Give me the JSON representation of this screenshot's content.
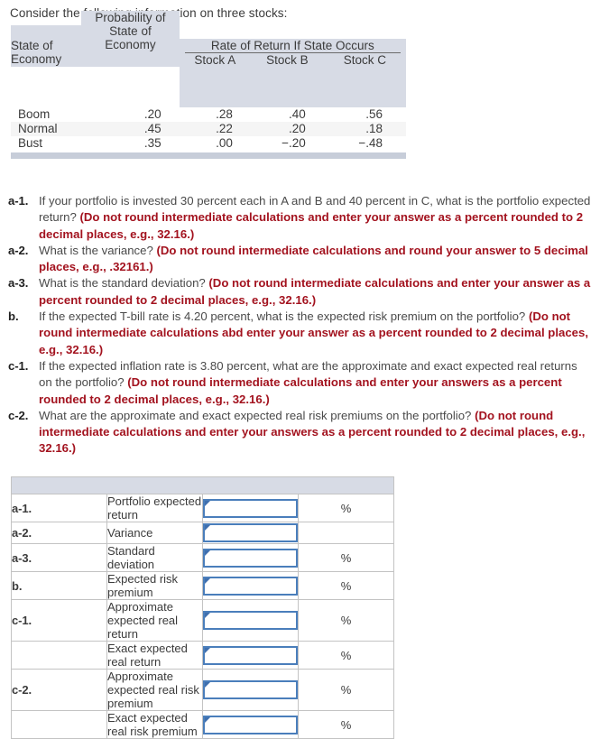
{
  "intro": "Consider the following information on three stocks:",
  "data_table": {
    "spanner": "Rate of Return If State Occurs",
    "row_header_1": "State of\nEconomy",
    "row_header_2": "Probability of\nState of\nEconomy",
    "columns": [
      "Stock A",
      "Stock B",
      "Stock C"
    ],
    "rows": [
      {
        "state": "Boom",
        "probability": ".20",
        "stock_a": ".28",
        "stock_b": ".40",
        "stock_c": ".56"
      },
      {
        "state": "Normal",
        "probability": ".45",
        "stock_a": ".22",
        "stock_b": ".20",
        "stock_c": ".18"
      },
      {
        "state": "Bust",
        "probability": ".35",
        "stock_a": ".00",
        "stock_b": "−.20",
        "stock_c": "−.48"
      }
    ]
  },
  "questions": [
    {
      "label": "a-1.",
      "plain_1": "If your portfolio is invested 30 percent each in A and B and 40 percent in C, what is the portfolio expected return? ",
      "emphasis": "(Do not round intermediate calculations and enter your answer as a percent rounded to 2 decimal places, e.g., 32.16.)"
    },
    {
      "label": "a-2.",
      "plain_1": "What is the variance? ",
      "emphasis": "(Do not round intermediate calculations and round your answer to 5 decimal places, e.g., .32161.)"
    },
    {
      "label": "a-3.",
      "plain_1": "What is the standard deviation? ",
      "emphasis": "(Do not round intermediate calculations and enter your answer as a percent rounded to 2 decimal places, e.g., 32.16.)"
    },
    {
      "label": "b.",
      "plain_1": "If the expected T-bill rate is 4.20 percent, what is the expected risk premium on the portfolio? ",
      "emphasis": "(Do not round intermediate calculations abd enter your answer as a percent rounded to 2 decimal places, e.g., 32.16.)"
    },
    {
      "label": "c-1.",
      "plain_1": "If the expected inflation rate is 3.80 percent, what are the approximate and exact expected real returns on the portfolio? ",
      "emphasis": "(Do not round intermediate calculations and enter your answers as a percent rounded to 2 decimal places, e.g., 32.16.)"
    },
    {
      "label": "c-2.",
      "plain_1": "What are the approximate and exact expected real risk premiums on the portfolio? ",
      "emphasis": "(Do not round intermediate calculations and enter your answers as a percent rounded to 2 decimal places, e.g., 32.16.)"
    }
  ],
  "answer_table": {
    "rows": [
      {
        "key": "a-1.",
        "desc": "Portfolio expected return",
        "value": "",
        "unit": "%"
      },
      {
        "key": "a-2.",
        "desc": "Variance",
        "value": "",
        "unit": ""
      },
      {
        "key": "a-3.",
        "desc": "Standard deviation",
        "value": "",
        "unit": "%"
      },
      {
        "key": "b.",
        "desc": "Expected risk premium",
        "value": "",
        "unit": "%"
      },
      {
        "key": "c-1.",
        "desc": "Approximate expected real return",
        "value": "",
        "unit": "%"
      },
      {
        "key": "",
        "desc": "Exact expected real return",
        "value": "",
        "unit": "%"
      },
      {
        "key": "c-2.",
        "desc": "Approximate expected real risk premium",
        "value": "",
        "unit": "%"
      },
      {
        "key": "",
        "desc": "Exact expected real risk premium",
        "value": "",
        "unit": "%"
      }
    ]
  },
  "colors": {
    "header_bg": "#d7dbe5",
    "alt_row_bg": "#f5f5f5",
    "emphasis_red": "#a3131f",
    "input_border": "#4a7ebb",
    "table_border": "#c3c3c3"
  }
}
